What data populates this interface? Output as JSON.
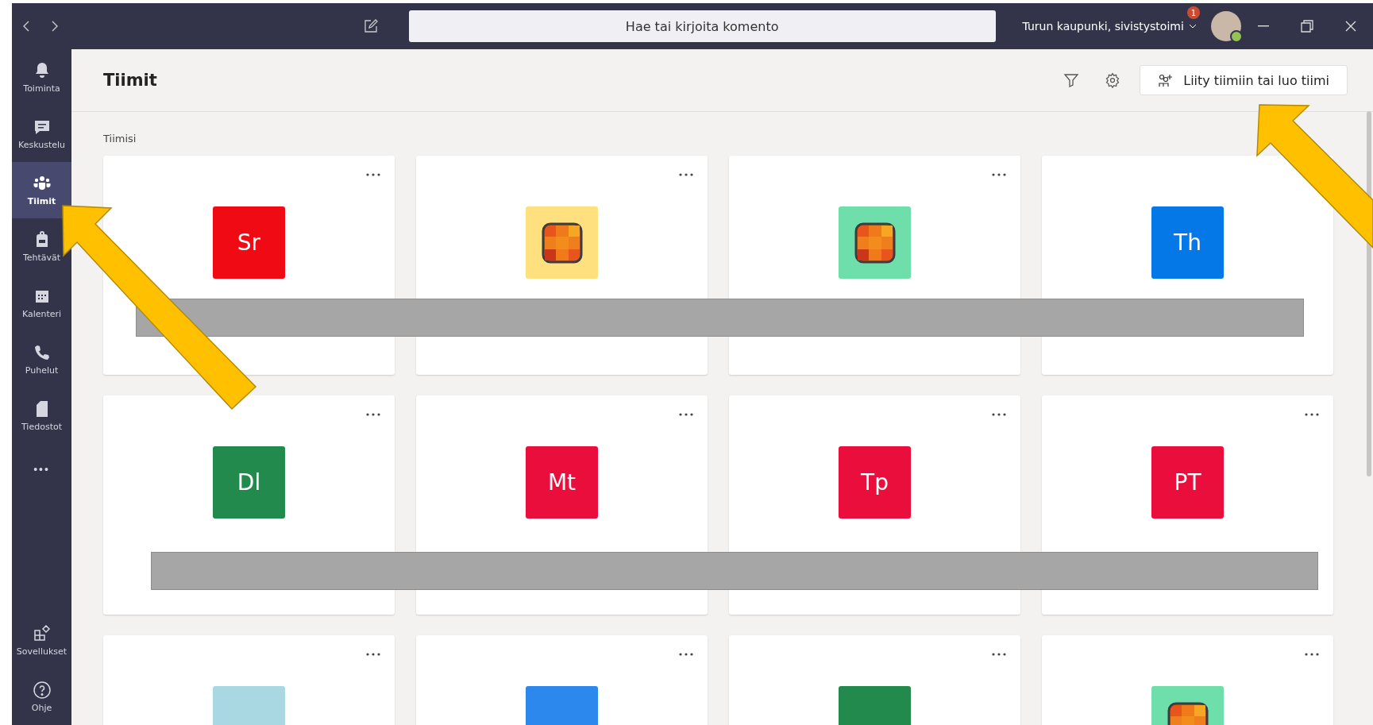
{
  "titlebar": {
    "search": {
      "placeholder": "Hae tai kirjoita komento"
    },
    "org": "Turun kaupunki, sivistystoimi",
    "notification_count": "1"
  },
  "nav": {
    "items": [
      {
        "label": "Toiminta",
        "selected": false
      },
      {
        "label": "Keskustelu",
        "selected": false
      },
      {
        "label": "Tiimit",
        "selected": true
      },
      {
        "label": "Tehtävät",
        "selected": false
      },
      {
        "label": "Kalenteri",
        "selected": false
      },
      {
        "label": "Puhelut",
        "selected": false
      },
      {
        "label": "Tiedostot",
        "selected": false
      }
    ],
    "more": "•••",
    "bottom": [
      {
        "label": "Sovellukset"
      },
      {
        "label": "Ohje"
      }
    ]
  },
  "header": {
    "title": "Tiimit",
    "join_button": "Liity tiimiin tai luo tiimi"
  },
  "section_label": "Tiimisi",
  "teams": [
    {
      "kind": "initials",
      "initials": "Sr",
      "color": "#f00a14"
    },
    {
      "kind": "grid",
      "color": "#ffe07f"
    },
    {
      "kind": "grid",
      "color": "#6edeaa"
    },
    {
      "kind": "initials",
      "initials": "Th",
      "color": "#0578e8"
    },
    {
      "kind": "initials",
      "initials": "Dl",
      "color": "#228a4c"
    },
    {
      "kind": "initials",
      "initials": "Mt",
      "color": "#ea0e3d"
    },
    {
      "kind": "initials",
      "initials": "Tp",
      "color": "#ea0e3d"
    },
    {
      "kind": "initials",
      "initials": "PT",
      "color": "#ea0e3d"
    },
    {
      "kind": "sticks",
      "color": "#a9d8e2"
    },
    {
      "kind": "blank",
      "color": "#2d88ee"
    },
    {
      "kind": "blank",
      "color": "#228a4c"
    },
    {
      "kind": "grid",
      "color": "#6edeaa"
    }
  ]
}
